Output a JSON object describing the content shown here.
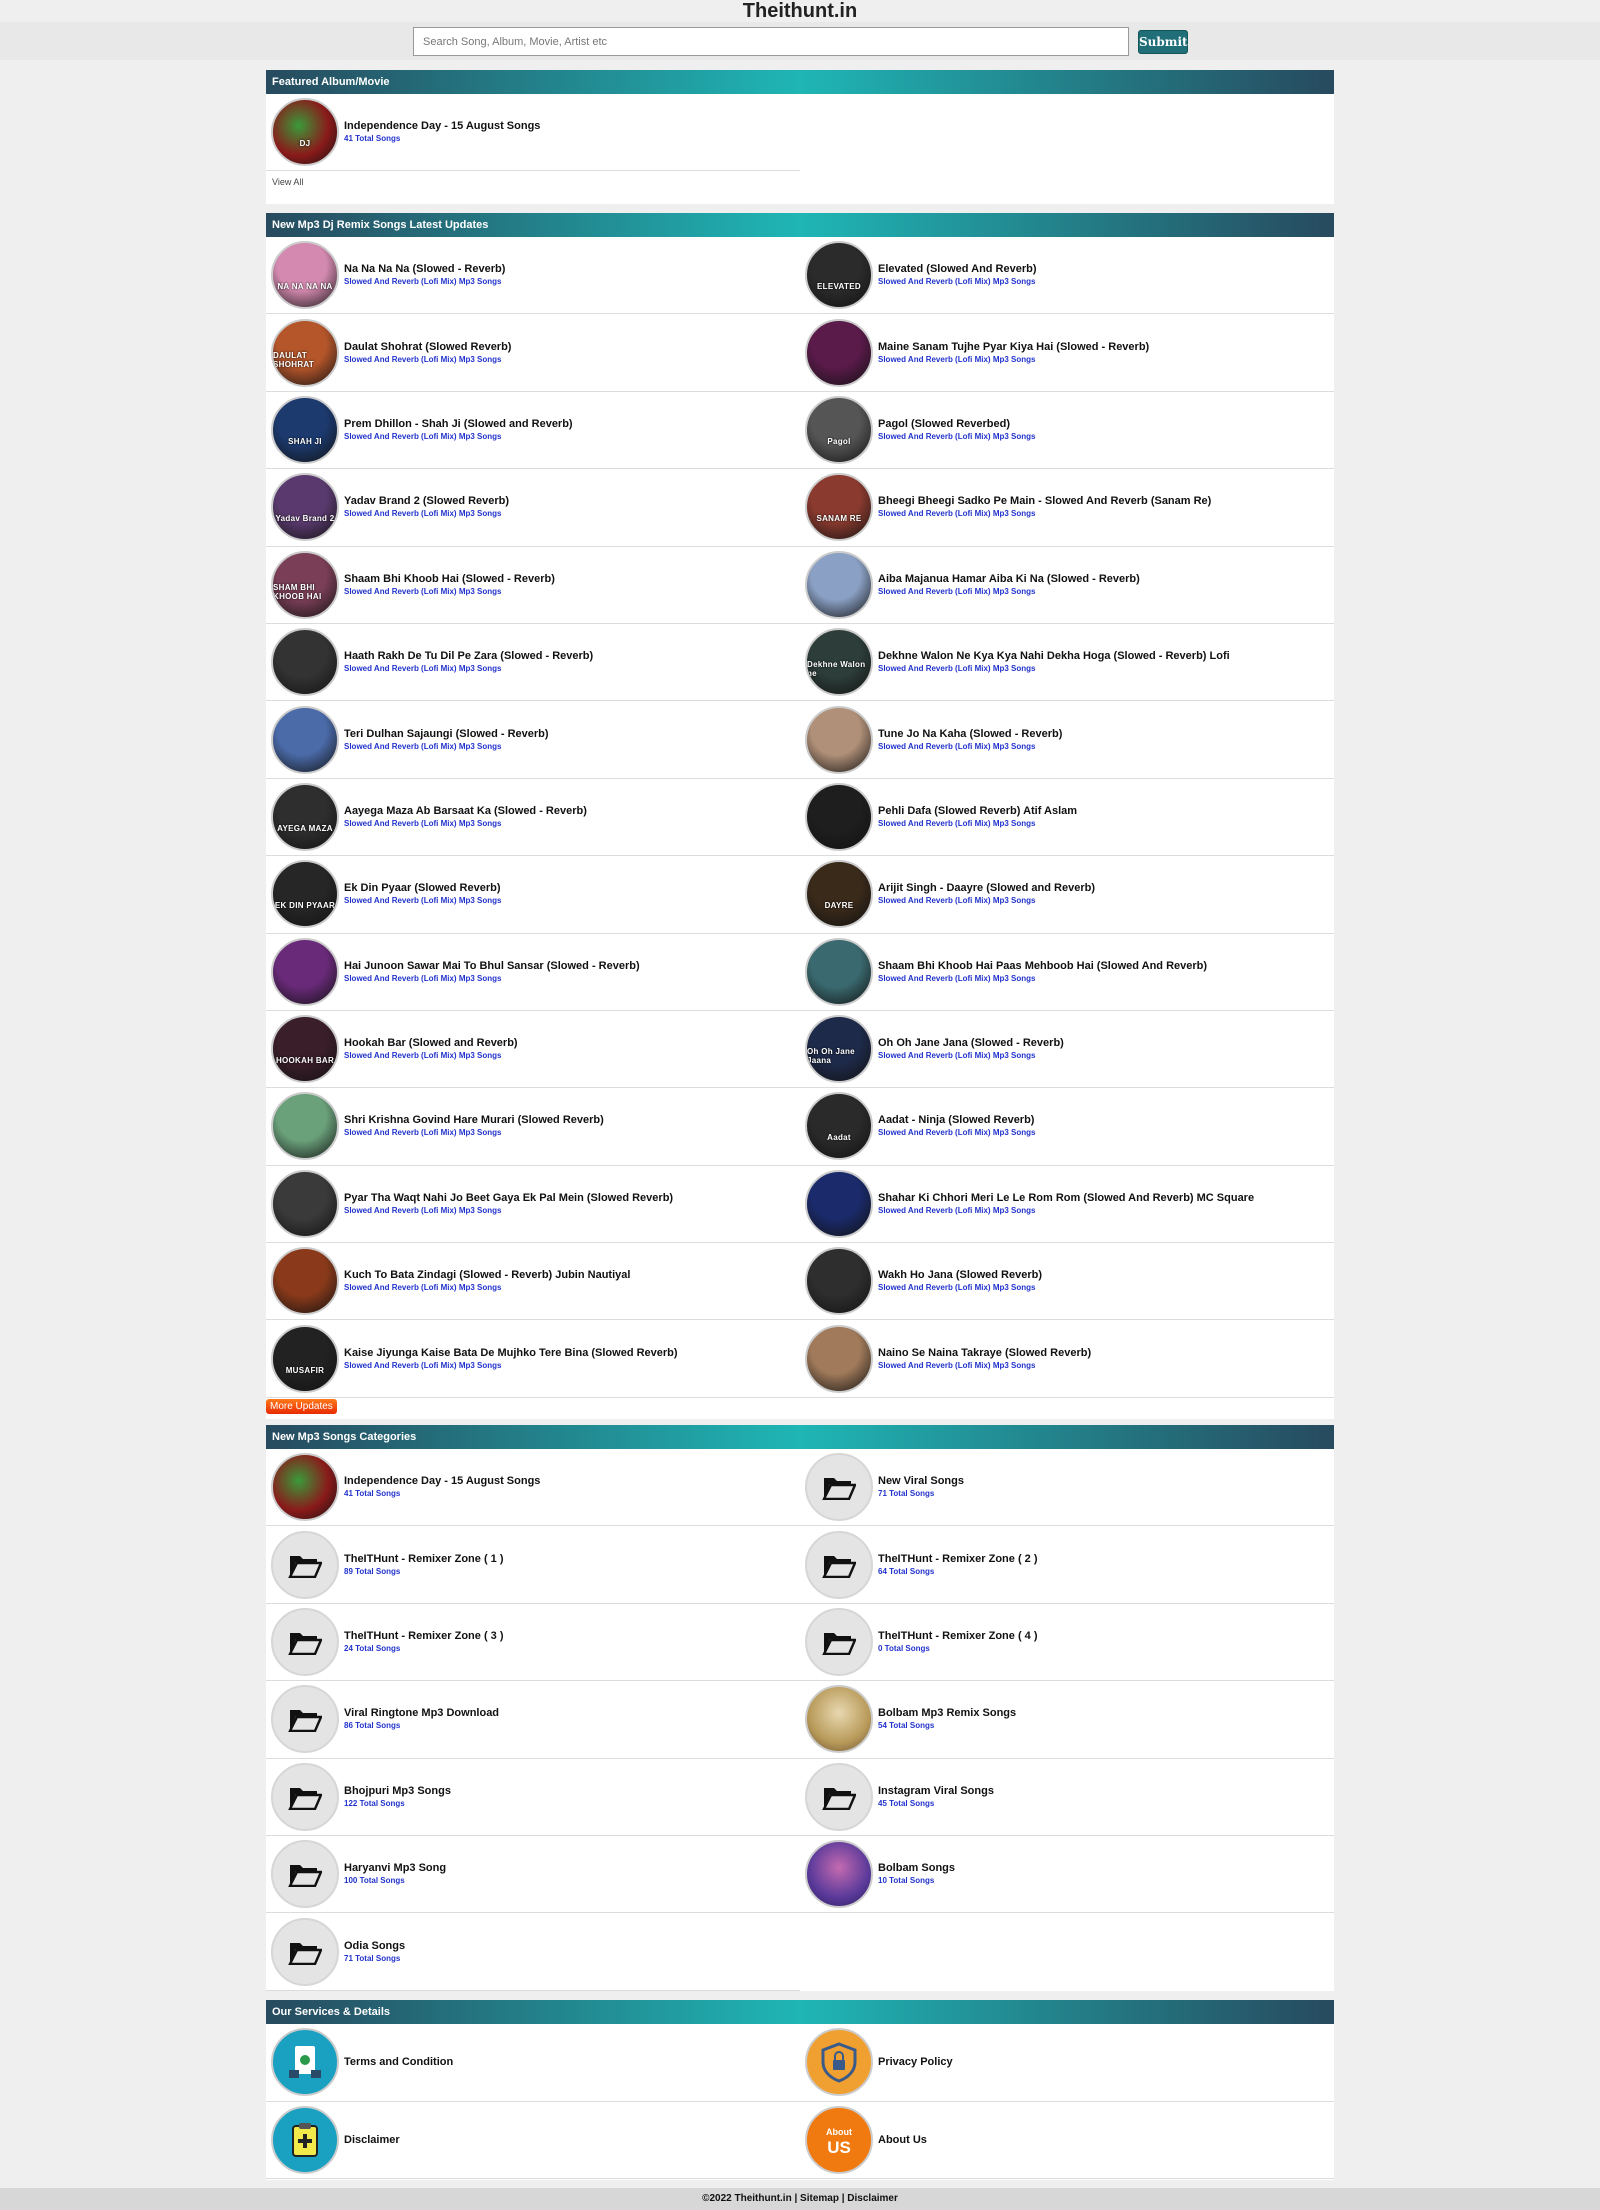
{
  "header": {
    "site_title": "Theithunt.in",
    "search_placeholder": "Search Song, Album, Movie, Artist etc",
    "submit_label": "Submit"
  },
  "featured": {
    "title": "Featured Album/Movie",
    "items": [
      {
        "name": "Independence Day - 15 August Songs",
        "sub": "41 Total Songs"
      }
    ],
    "view_all": "View All"
  },
  "latest": {
    "title": "New Mp3 Dj Remix Songs Latest Updates",
    "items": [
      {
        "name": "Na Na Na Na (Slowed - Reverb)",
        "sub": "Slowed And Reverb (Lofi Mix) Mp3 Songs",
        "art": "NA NA NA NA",
        "color": "#d48ab0"
      },
      {
        "name": "Elevated (Slowed And Reverb)",
        "sub": "Slowed And Reverb (Lofi Mix) Mp3 Songs",
        "art": "ELEVATED",
        "color": "#2b2b2b"
      },
      {
        "name": "Daulat Shohrat (Slowed Reverb)",
        "sub": "Slowed And Reverb (Lofi Mix) Mp3 Songs",
        "art": "DAULAT SHOHRAT",
        "color": "#b4552a"
      },
      {
        "name": "Maine Sanam Tujhe Pyar Kiya Hai (Slowed - Reverb)",
        "sub": "Slowed And Reverb (Lofi Mix) Mp3 Songs",
        "art": "",
        "color": "#5a1a4a"
      },
      {
        "name": "Prem Dhillon - Shah Ji (Slowed and Reverb)",
        "sub": "Slowed And Reverb (Lofi Mix) Mp3 Songs",
        "art": "SHAH JI",
        "color": "#1c3a6e"
      },
      {
        "name": "Pagol (Slowed Reverbed)",
        "sub": "Slowed And Reverb (Lofi Mix) Mp3 Songs",
        "art": "Pagol",
        "color": "#555555"
      },
      {
        "name": "Yadav Brand 2 (Slowed Reverb)",
        "sub": "Slowed And Reverb (Lofi Mix) Mp3 Songs",
        "art": "Yadav Brand 2",
        "color": "#5a3a6e"
      },
      {
        "name": "Bheegi Bheegi Sadko Pe Main - Slowed And Reverb (Sanam Re)",
        "sub": "Slowed And Reverb (Lofi Mix) Mp3 Songs",
        "art": "SANAM RE",
        "color": "#8a3a2e"
      },
      {
        "name": "Shaam Bhi Khoob Hai (Slowed - Reverb)",
        "sub": "Slowed And Reverb (Lofi Mix) Mp3 Songs",
        "art": "SHAM BHI KHOOB HAI",
        "color": "#7a3e56"
      },
      {
        "name": "Aiba Majanua Hamar Aiba Ki Na (Slowed - Reverb)",
        "sub": "Slowed And Reverb (Lofi Mix) Mp3 Songs",
        "art": "",
        "color": "#8aa0c4"
      },
      {
        "name": "Haath Rakh De Tu Dil Pe Zara (Slowed - Reverb)",
        "sub": "Slowed And Reverb (Lofi Mix) Mp3 Songs",
        "art": "",
        "color": "#333333"
      },
      {
        "name": "Dekhne Walon Ne Kya Kya Nahi Dekha Hoga (Slowed - Reverb) Lofi",
        "sub": "Slowed And Reverb (Lofi Mix) Mp3 Songs",
        "art": "Dekhne Walon ne",
        "color": "#2d3e3a"
      },
      {
        "name": "Teri Dulhan Sajaungi (Slowed - Reverb)",
        "sub": "Slowed And Reverb (Lofi Mix) Mp3 Songs",
        "art": "",
        "color": "#4a6aa8"
      },
      {
        "name": "Tune Jo Na Kaha (Slowed - Reverb)",
        "sub": "Slowed And Reverb (Lofi Mix) Mp3 Songs",
        "art": "",
        "color": "#b09078"
      },
      {
        "name": "Aayega Maza Ab Barsaat Ka (Slowed - Reverb)",
        "sub": "Slowed And Reverb (Lofi Mix) Mp3 Songs",
        "art": "AYEGA MAZA",
        "color": "#2e2e2e"
      },
      {
        "name": "Pehli Dafa (Slowed Reverb) Atif Aslam",
        "sub": "Slowed And Reverb (Lofi Mix) Mp3 Songs",
        "art": "",
        "color": "#1e1e1e"
      },
      {
        "name": "Ek Din Pyaar (Slowed Reverb)",
        "sub": "Slowed And Reverb (Lofi Mix) Mp3 Songs",
        "art": "EK DIN PYAAR",
        "color": "#262626"
      },
      {
        "name": "Arijit Singh - Daayre (Slowed and Reverb)",
        "sub": "Slowed And Reverb (Lofi Mix) Mp3 Songs",
        "art": "DAYRE",
        "color": "#3a2a1a"
      },
      {
        "name": "Hai Junoon Sawar Mai To Bhul Sansar (Slowed - Reverb)",
        "sub": "Slowed And Reverb (Lofi Mix) Mp3 Songs",
        "art": "",
        "color": "#6a2a7a"
      },
      {
        "name": "Shaam Bhi Khoob Hai Paas Mehboob Hai (Slowed And Reverb)",
        "sub": "Slowed And Reverb (Lofi Mix) Mp3 Songs",
        "art": "",
        "color": "#3a6a70"
      },
      {
        "name": "Hookah Bar (Slowed and Reverb)",
        "sub": "Slowed And Reverb (Lofi Mix) Mp3 Songs",
        "art": "HOOKAH BAR",
        "color": "#3a1e2a"
      },
      {
        "name": "Oh Oh Jane Jana (Slowed - Reverb)",
        "sub": "Slowed And Reverb (Lofi Mix) Mp3 Songs",
        "art": "Oh Oh Jane Jaana",
        "color": "#1e2a4a"
      },
      {
        "name": "Shri Krishna Govind Hare Murari (Slowed Reverb)",
        "sub": "Slowed And Reverb (Lofi Mix) Mp3 Songs",
        "art": "",
        "color": "#6aa07a"
      },
      {
        "name": "Aadat - Ninja (Slowed Reverb)",
        "sub": "Slowed And Reverb (Lofi Mix) Mp3 Songs",
        "art": "Aadat",
        "color": "#2a2a2a"
      },
      {
        "name": "Pyar Tha Waqt Nahi Jo Beet Gaya Ek Pal Mein (Slowed Reverb)",
        "sub": "Slowed And Reverb (Lofi Mix) Mp3 Songs",
        "art": "",
        "color": "#3a3a3a"
      },
      {
        "name": "Shahar Ki Chhori Meri Le Le Rom Rom (Slowed And Reverb) MC Square",
        "sub": "Slowed And Reverb (Lofi Mix) Mp3 Songs",
        "art": "",
        "color": "#1a2a6a"
      },
      {
        "name": "Kuch To Bata Zindagi (Slowed - Reverb) Jubin Nautiyal",
        "sub": "Slowed And Reverb (Lofi Mix) Mp3 Songs",
        "art": "",
        "color": "#8a3a1a"
      },
      {
        "name": "Wakh Ho Jana (Slowed Reverb)",
        "sub": "Slowed And Reverb (Lofi Mix) Mp3 Songs",
        "art": "",
        "color": "#2e2e2e"
      },
      {
        "name": "Kaise Jiyunga Kaise Bata De Mujhko Tere Bina (Slowed Reverb)",
        "sub": "Slowed And Reverb (Lofi Mix) Mp3 Songs",
        "art": "MUSAFIR",
        "color": "#222222"
      },
      {
        "name": "Naino Se Naina Takraye (Slowed Reverb)",
        "sub": "Slowed And Reverb (Lofi Mix) Mp3 Songs",
        "art": "",
        "color": "#a07a5a"
      }
    ],
    "more_label": "More Updates"
  },
  "categories": {
    "title": "New Mp3 Songs Categories",
    "items": [
      {
        "name": "Independence Day - 15 August Songs",
        "sub": "41 Total Songs",
        "icon": "album-art"
      },
      {
        "name": "New Viral Songs",
        "sub": "71 Total Songs",
        "icon": "folder-icon"
      },
      {
        "name": "TheITHunt - Remixer Zone ( 1 )",
        "sub": "89 Total Songs",
        "icon": "folder-icon"
      },
      {
        "name": "TheITHunt - Remixer Zone ( 2 )",
        "sub": "64 Total Songs",
        "icon": "folder-icon"
      },
      {
        "name": "TheITHunt - Remixer Zone ( 3 )",
        "sub": "24 Total Songs",
        "icon": "folder-icon"
      },
      {
        "name": "TheITHunt - Remixer Zone ( 4 )",
        "sub": "0 Total Songs",
        "icon": "folder-icon"
      },
      {
        "name": "Viral Ringtone Mp3 Download",
        "sub": "86 Total Songs",
        "icon": "folder-icon"
      },
      {
        "name": "Bolbam Mp3 Remix Songs",
        "sub": "54 Total Songs",
        "icon": "album-art"
      },
      {
        "name": "Bhojpuri Mp3 Songs",
        "sub": "122 Total Songs",
        "icon": "folder-icon"
      },
      {
        "name": "Instagram Viral Songs",
        "sub": "45 Total Songs",
        "icon": "folder-icon"
      },
      {
        "name": "Haryanvi Mp3 Song",
        "sub": "100 Total Songs",
        "icon": "folder-icon"
      },
      {
        "name": "Bolbam Songs",
        "sub": "10 Total Songs",
        "icon": "album-art"
      },
      {
        "name": "Odia Songs",
        "sub": "71 Total Songs",
        "icon": "folder-icon"
      }
    ]
  },
  "services": {
    "title": "Our Services & Details",
    "items": [
      {
        "name": "Terms and Condition",
        "icon": "terms-icon",
        "color": "#1aa0c0"
      },
      {
        "name": "Privacy Policy",
        "icon": "shield-lock-icon",
        "color": "#f0a030"
      },
      {
        "name": "Disclaimer",
        "icon": "clipboard-icon",
        "color": "#1aa0c0"
      },
      {
        "name": "About Us",
        "icon": "about-us-icon",
        "color": "#f07a10"
      }
    ]
  },
  "footer": {
    "text": "©2022 Theithunt.in | Sitemap | Disclaimer"
  }
}
